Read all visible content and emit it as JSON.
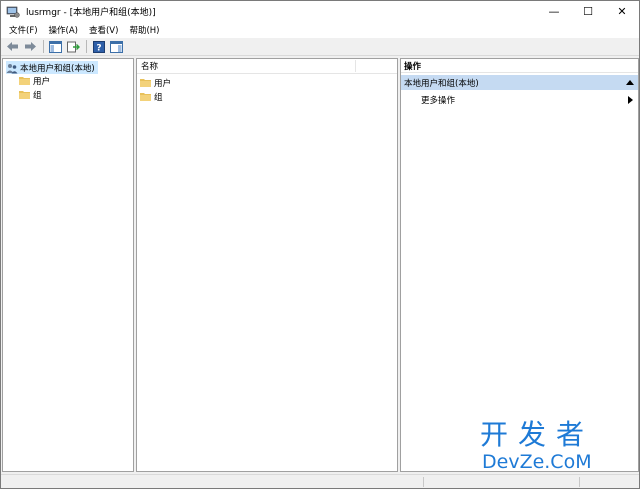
{
  "window": {
    "title": "lusrmgr - [本地用户和组(本地)]",
    "minimize_glyph": "—",
    "maximize_glyph": "☐",
    "close_glyph": "✕"
  },
  "menu": {
    "items": [
      "文件(F)",
      "操作(A)",
      "查看(V)",
      "帮助(H)"
    ]
  },
  "toolbar": {
    "icons": [
      "back-arrow-icon",
      "forward-arrow-icon",
      "show-hide-console-tree-icon",
      "export-list-icon",
      "help-icon",
      "show-hide-action-pane-icon"
    ]
  },
  "tree": {
    "root": "本地用户和组(本地)",
    "children": [
      "用户",
      "组"
    ]
  },
  "list": {
    "column_header": "名称",
    "items": [
      "用户",
      "组"
    ]
  },
  "actions": {
    "header": "操作",
    "group_title": "本地用户和组(本地)",
    "more_actions": "更多操作"
  },
  "watermark": {
    "line1": "开发者",
    "line2": "DevZe.CoM"
  },
  "colors": {
    "selection": "#cce8ff",
    "actions_group_bg": "#c5daf2",
    "folder": "#e8c15a",
    "watermark": "#1e7ad6"
  }
}
